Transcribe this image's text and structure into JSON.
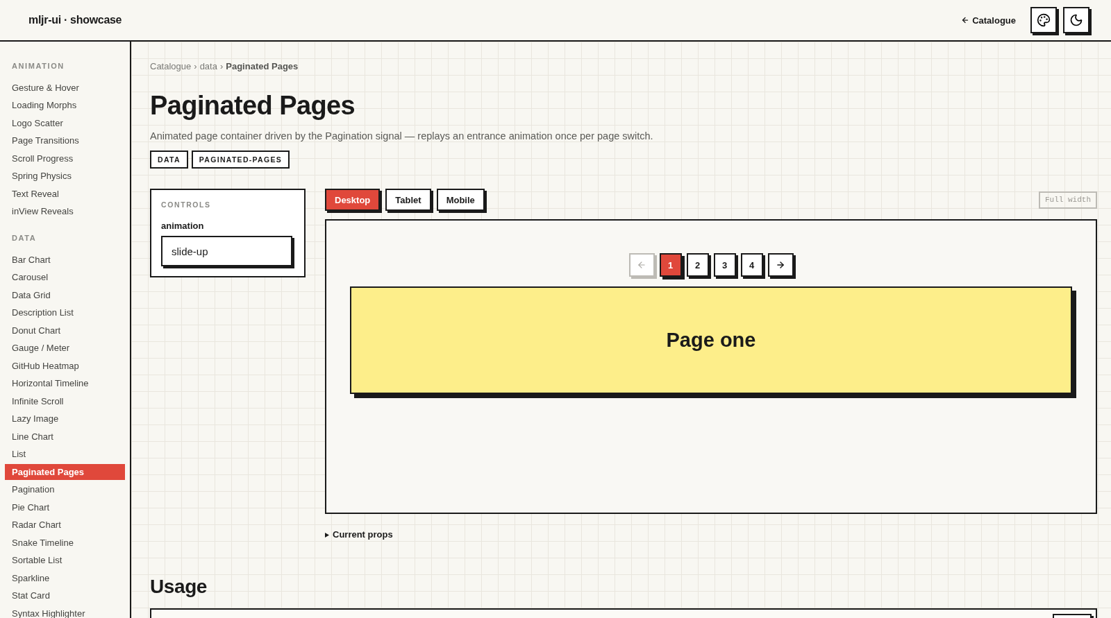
{
  "header": {
    "logo": "mljr-ui · showcase",
    "back_link": "Catalogue"
  },
  "sidebar": {
    "sections": [
      {
        "title": "ANIMATION",
        "items": [
          {
            "label": "Gesture & Hover",
            "selected": false
          },
          {
            "label": "Loading Morphs",
            "selected": false
          },
          {
            "label": "Logo Scatter",
            "selected": false
          },
          {
            "label": "Page Transitions",
            "selected": false
          },
          {
            "label": "Scroll Progress",
            "selected": false
          },
          {
            "label": "Spring Physics",
            "selected": false
          },
          {
            "label": "Text Reveal",
            "selected": false
          },
          {
            "label": "inView Reveals",
            "selected": false
          }
        ]
      },
      {
        "title": "DATA",
        "items": [
          {
            "label": "Bar Chart",
            "selected": false
          },
          {
            "label": "Carousel",
            "selected": false
          },
          {
            "label": "Data Grid",
            "selected": false
          },
          {
            "label": "Description List",
            "selected": false
          },
          {
            "label": "Donut Chart",
            "selected": false
          },
          {
            "label": "Gauge / Meter",
            "selected": false
          },
          {
            "label": "GitHub Heatmap",
            "selected": false
          },
          {
            "label": "Horizontal Timeline",
            "selected": false
          },
          {
            "label": "Infinite Scroll",
            "selected": false
          },
          {
            "label": "Lazy Image",
            "selected": false
          },
          {
            "label": "Line Chart",
            "selected": false
          },
          {
            "label": "List",
            "selected": false
          },
          {
            "label": "Paginated Pages",
            "selected": true
          },
          {
            "label": "Pagination",
            "selected": false
          },
          {
            "label": "Pie Chart",
            "selected": false
          },
          {
            "label": "Radar Chart",
            "selected": false
          },
          {
            "label": "Snake Timeline",
            "selected": false
          },
          {
            "label": "Sortable List",
            "selected": false
          },
          {
            "label": "Sparkline",
            "selected": false
          },
          {
            "label": "Stat Card",
            "selected": false
          },
          {
            "label": "Syntax Highlighter",
            "selected": false
          }
        ]
      }
    ]
  },
  "breadcrumb": [
    {
      "kind": "link",
      "label": "Catalogue"
    },
    {
      "kind": "separator",
      "label": "›"
    },
    {
      "kind": "link",
      "label": "data"
    },
    {
      "kind": "separator",
      "label": "›"
    },
    {
      "kind": "current",
      "label": "Paginated Pages"
    }
  ],
  "title": "Paginated Pages",
  "description": "Animated page container driven by the Pagination signal — replays an entrance animation once per page switch.",
  "tags": [
    "DATA",
    "PAGINATED-PAGES"
  ],
  "controls": {
    "title": "CONTROLS",
    "fields": [
      {
        "label": "animation",
        "value": "slide-up"
      }
    ]
  },
  "viewport_tabs": [
    {
      "label": "Desktop",
      "selected": true
    },
    {
      "label": "Tablet",
      "selected": false
    },
    {
      "label": "Mobile",
      "selected": false
    }
  ],
  "full_width_button": "Full width",
  "preview": {
    "pagination": {
      "prev": {
        "disabled": true
      },
      "pages": [
        {
          "label": "1",
          "selected": true
        },
        {
          "label": "2",
          "selected": false
        },
        {
          "label": "3",
          "selected": false
        },
        {
          "label": "4",
          "selected": false
        }
      ],
      "next": {
        "disabled": false
      }
    },
    "page_content": "Page one"
  },
  "current_props": {
    "label": "Current props",
    "expanded": false
  },
  "usage": {
    "title": "Usage"
  }
}
